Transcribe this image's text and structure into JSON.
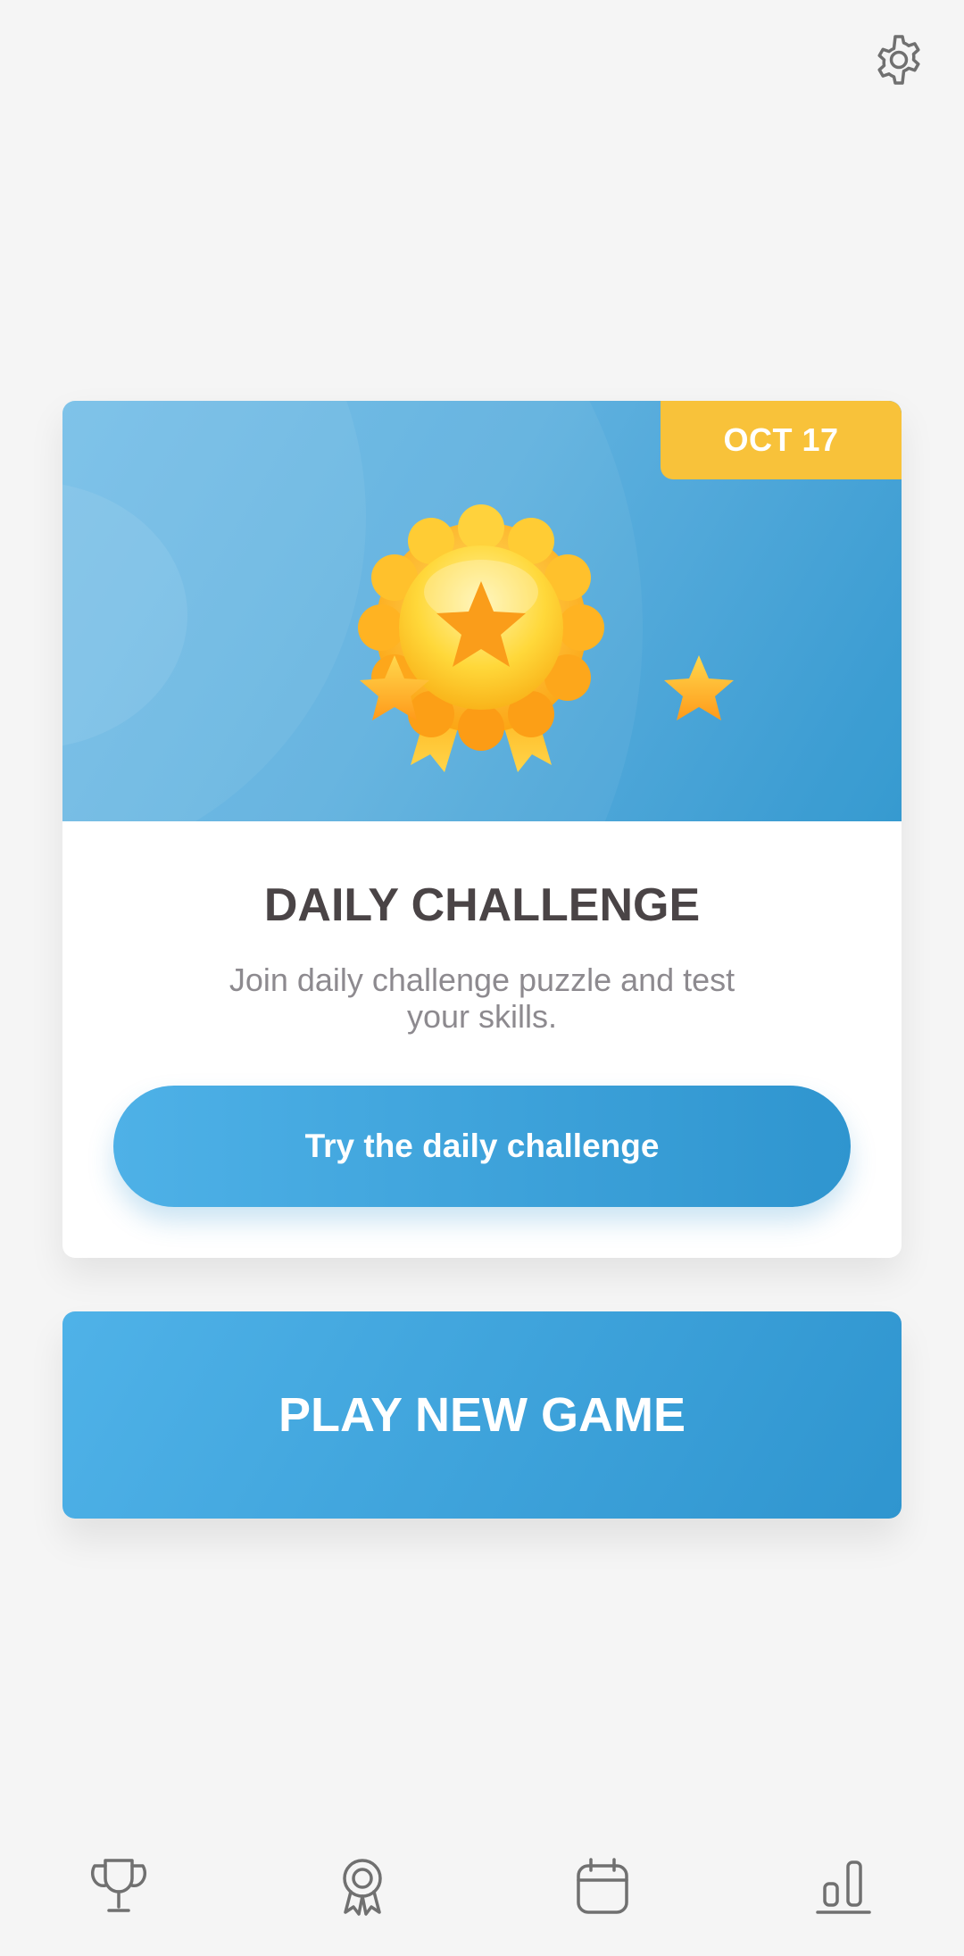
{
  "header": {
    "settings_icon": "gear-icon"
  },
  "daily_challenge": {
    "date": "OCT 17",
    "title": "DAILY CHALLENGE",
    "description": "Join daily challenge puzzle and test your skills.",
    "button_label": "Try the daily challenge"
  },
  "play": {
    "button_label": "PLAY NEW GAME"
  },
  "bottom_nav": [
    {
      "icon": "trophy-icon"
    },
    {
      "icon": "award-ribbon-icon"
    },
    {
      "icon": "calendar-icon"
    },
    {
      "icon": "bar-chart-icon"
    }
  ],
  "colors": {
    "accent_blue": "#3ba3db",
    "date_tag": "#f8c23a",
    "background": "#f5f5f5",
    "title_text": "#4a4446",
    "subtitle_text": "#8d8a8f"
  }
}
